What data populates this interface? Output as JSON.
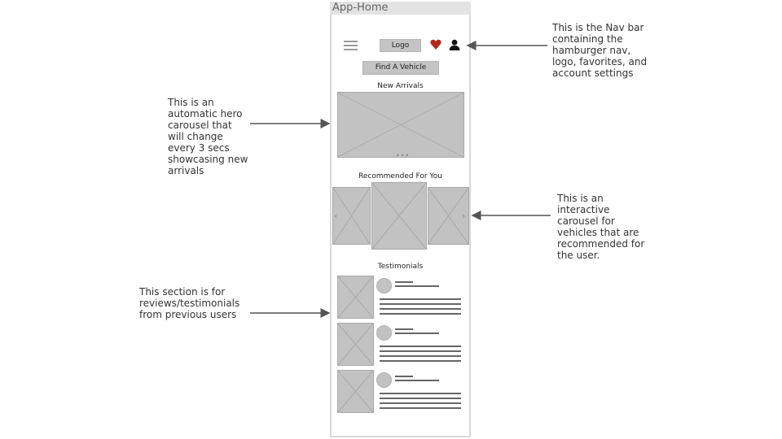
{
  "frame": {
    "title": "App-Home"
  },
  "nav": {
    "menu_icon": "hamburger-icon",
    "logo_label": "Logo",
    "favorites_icon": "heart-icon",
    "account_icon": "user-icon",
    "heart_color": "#b3261e"
  },
  "find_button": {
    "label": "Find A Vehicle"
  },
  "new_arrivals": {
    "title": "New Arrivals",
    "indicator": "•••"
  },
  "recommended": {
    "title": "Recommended For You",
    "prev_icon": "chevron-left-icon",
    "next_icon": "chevron-right-icon"
  },
  "testimonials": {
    "title": "Testimonials",
    "count": 3
  },
  "annotations": {
    "nav": "This is the Nav bar containing the hamburger nav, logo, favorites, and account settings",
    "hero": "This is an automatic hero carousel that will change every 3 secs showcasing new arrivals",
    "recommended": "This is an interactive carousel for vehicles that are recommended for the user.",
    "testimonials": "This section is for reviews/testimonials from previous users"
  }
}
